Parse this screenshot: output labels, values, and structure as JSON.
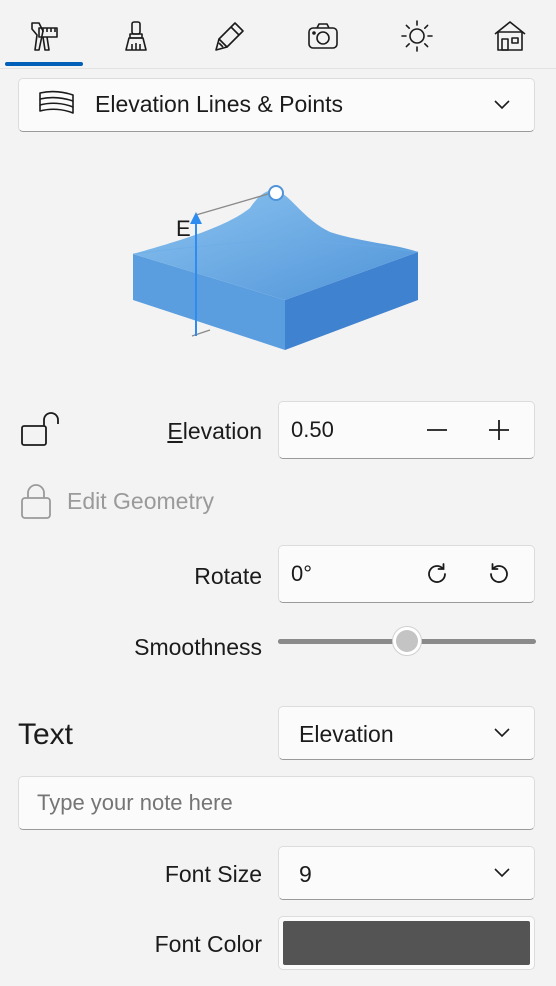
{
  "toolbar": {
    "tools": [
      {
        "name": "measure",
        "icon": "ruler-compass-icon",
        "selected": true
      },
      {
        "name": "paint",
        "icon": "paint-brush-icon"
      },
      {
        "name": "edit",
        "icon": "pencil-icon"
      },
      {
        "name": "camera",
        "icon": "camera-icon"
      },
      {
        "name": "lighting",
        "icon": "sun-icon"
      },
      {
        "name": "house",
        "icon": "house-icon"
      }
    ],
    "accent_color": "#005fb8"
  },
  "object_type": {
    "selected": "Elevation Lines & Points",
    "icon": "terrain-layers-icon"
  },
  "preview": {
    "axis_label": "E"
  },
  "elevation": {
    "label": "Elevation",
    "value": "0.50",
    "decrement": "−",
    "increment": "+"
  },
  "edit_geometry": {
    "label": "Edit Geometry",
    "enabled": false
  },
  "rotate": {
    "label": "Rotate",
    "value": "0°"
  },
  "smoothness": {
    "label": "Smoothness",
    "value_fraction": 0.5
  },
  "text": {
    "heading": "Text",
    "source": "Elevation",
    "note_placeholder": "Type your note here",
    "font_size_label": "Font Size",
    "font_size": "9",
    "font_color_label": "Font Color",
    "font_color": "#545454"
  }
}
